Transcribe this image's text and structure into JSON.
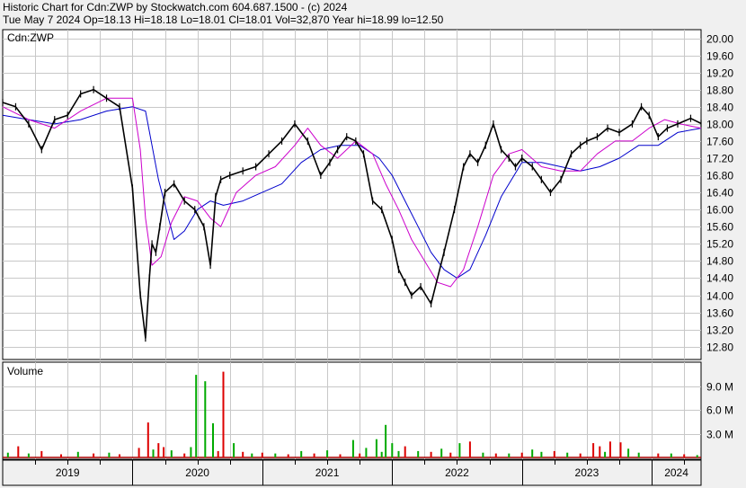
{
  "header": {
    "line1": "Historic Chart for Cdn:ZWP by Stockwatch.com 604.687.1500 - (c) 2024",
    "line2": "Tue May  7 2024  Op=18.13  Hi=18.18  Lo=18.01  Cl=18.01  Vol=32,870  Year hi=18.99  lo=12.50"
  },
  "colors": {
    "price_bars": "#000000",
    "ma_short": "#cc00cc",
    "ma_long": "#0000cc",
    "volume_up": "#00aa00",
    "volume_down": "#dd0000",
    "grid": "#c8c8c8"
  },
  "chart_data": [
    {
      "type": "line",
      "panel": "price",
      "title": "Cdn:ZWP",
      "ylim": [
        12.5,
        20.2
      ],
      "yticks": [
        "20.00",
        "19.60",
        "19.20",
        "18.80",
        "18.40",
        "18.00",
        "17.60",
        "17.20",
        "16.80",
        "16.40",
        "16.00",
        "15.60",
        "15.20",
        "14.80",
        "14.40",
        "14.00",
        "13.60",
        "13.20",
        "12.80"
      ],
      "x_axis_labels": [
        "2019",
        "2020",
        "2021",
        "2022",
        "2023",
        "2024"
      ],
      "x_range": [
        2019.0,
        2024.38
      ],
      "series": [
        {
          "role": "price",
          "x": [
            2019.0,
            2019.1,
            2019.2,
            2019.3,
            2019.4,
            2019.5,
            2019.6,
            2019.7,
            2019.8,
            2019.9,
            2020.0,
            2020.06,
            2020.1,
            2020.13,
            2020.15,
            2020.18,
            2020.21,
            2020.25,
            2020.32,
            2020.4,
            2020.48,
            2020.55,
            2020.6,
            2020.64,
            2020.68,
            2020.75,
            2020.85,
            2020.95,
            2021.05,
            2021.15,
            2021.25,
            2021.35,
            2021.45,
            2021.52,
            2021.58,
            2021.65,
            2021.72,
            2021.78,
            2021.85,
            2021.92,
            2022.0,
            2022.05,
            2022.1,
            2022.15,
            2022.22,
            2022.3,
            2022.4,
            2022.48,
            2022.55,
            2022.6,
            2022.66,
            2022.72,
            2022.78,
            2022.84,
            2022.9,
            2022.95,
            2023.0,
            2023.08,
            2023.15,
            2023.22,
            2023.3,
            2023.38,
            2023.45,
            2023.5,
            2023.58,
            2023.66,
            2023.75,
            2023.85,
            2023.92,
            2023.98,
            2024.05,
            2024.12,
            2024.2,
            2024.3,
            2024.38
          ],
          "y": [
            18.5,
            18.4,
            18.0,
            17.4,
            18.1,
            18.2,
            18.7,
            18.8,
            18.6,
            18.4,
            16.5,
            14.0,
            13.0,
            14.4,
            15.2,
            15.0,
            15.6,
            16.4,
            16.6,
            16.2,
            16.0,
            15.6,
            14.7,
            16.3,
            16.7,
            16.8,
            16.9,
            17.0,
            17.3,
            17.6,
            18.0,
            17.6,
            16.8,
            17.1,
            17.4,
            17.7,
            17.6,
            17.3,
            16.2,
            16.0,
            15.3,
            14.6,
            14.3,
            14.0,
            14.2,
            13.8,
            15.0,
            16.0,
            17.0,
            17.3,
            17.1,
            17.5,
            18.0,
            17.4,
            17.2,
            17.0,
            17.2,
            17.0,
            16.7,
            16.4,
            16.7,
            17.3,
            17.5,
            17.6,
            17.7,
            17.9,
            17.8,
            18.0,
            18.4,
            18.2,
            17.7,
            17.9,
            18.0,
            18.13,
            18.01
          ]
        },
        {
          "role": "ma_short",
          "x": [
            2019.0,
            2019.2,
            2019.4,
            2019.6,
            2019.8,
            2020.0,
            2020.06,
            2020.1,
            2020.15,
            2020.22,
            2020.3,
            2020.4,
            2020.5,
            2020.6,
            2020.68,
            2020.8,
            2020.95,
            2021.1,
            2021.25,
            2021.35,
            2021.45,
            2021.58,
            2021.72,
            2021.85,
            2021.95,
            2022.05,
            2022.15,
            2022.25,
            2022.35,
            2022.45,
            2022.55,
            2022.66,
            2022.78,
            2022.9,
            2023.0,
            2023.15,
            2023.3,
            2023.45,
            2023.58,
            2023.72,
            2023.85,
            2023.98,
            2024.1,
            2024.22,
            2024.38
          ],
          "y": [
            18.4,
            18.1,
            17.9,
            18.3,
            18.6,
            18.6,
            17.4,
            15.8,
            14.7,
            14.9,
            15.7,
            16.3,
            16.2,
            15.8,
            15.6,
            16.4,
            16.8,
            17.0,
            17.5,
            17.9,
            17.5,
            17.2,
            17.6,
            17.3,
            16.6,
            16.0,
            15.3,
            14.8,
            14.3,
            14.2,
            14.6,
            15.6,
            16.8,
            17.3,
            17.4,
            17.0,
            16.9,
            16.9,
            17.3,
            17.6,
            17.6,
            17.9,
            18.1,
            18.0,
            17.9
          ]
        },
        {
          "role": "ma_long",
          "x": [
            2019.0,
            2019.2,
            2019.4,
            2019.6,
            2019.8,
            2020.0,
            2020.1,
            2020.2,
            2020.32,
            2020.4,
            2020.5,
            2020.6,
            2020.7,
            2020.85,
            2021.0,
            2021.15,
            2021.3,
            2021.45,
            2021.6,
            2021.75,
            2021.9,
            2022.0,
            2022.1,
            2022.2,
            2022.3,
            2022.4,
            2022.5,
            2022.6,
            2022.72,
            2022.84,
            2023.0,
            2023.15,
            2023.3,
            2023.45,
            2023.6,
            2023.75,
            2023.9,
            2024.05,
            2024.2,
            2024.38
          ],
          "y": [
            18.2,
            18.1,
            18.0,
            18.1,
            18.3,
            18.4,
            18.3,
            16.7,
            15.3,
            15.5,
            16.0,
            16.2,
            16.1,
            16.2,
            16.4,
            16.6,
            17.1,
            17.4,
            17.5,
            17.5,
            17.2,
            16.8,
            16.2,
            15.6,
            15.0,
            14.6,
            14.4,
            14.6,
            15.4,
            16.3,
            17.1,
            17.1,
            17.0,
            16.9,
            17.0,
            17.2,
            17.5,
            17.5,
            17.8,
            17.9
          ]
        }
      ]
    },
    {
      "type": "bar",
      "panel": "volume",
      "title": "Volume",
      "ylim": [
        0,
        12000000
      ],
      "yticks": [
        "9.0 M",
        "6.0 M",
        "3.0 M"
      ],
      "x_range": [
        2019.0,
        2024.38
      ],
      "series": [
        {
          "role": "volume",
          "x": [
            2019.04,
            2019.12,
            2019.2,
            2019.3,
            2019.45,
            2019.58,
            2019.7,
            2019.82,
            2019.9,
            2020.05,
            2020.12,
            2020.16,
            2020.2,
            2020.24,
            2020.3,
            2020.4,
            2020.45,
            2020.49,
            2020.56,
            2020.62,
            2020.66,
            2020.7,
            2020.78,
            2020.85,
            2020.92,
            2021.0,
            2021.1,
            2021.2,
            2021.3,
            2021.4,
            2021.5,
            2021.6,
            2021.7,
            2021.75,
            2021.8,
            2021.88,
            2021.92,
            2021.95,
            2022.0,
            2022.05,
            2022.1,
            2022.2,
            2022.3,
            2022.38,
            2022.45,
            2022.52,
            2022.6,
            2022.7,
            2022.8,
            2022.9,
            2023.0,
            2023.08,
            2023.15,
            2023.25,
            2023.35,
            2023.45,
            2023.55,
            2023.6,
            2023.64,
            2023.68,
            2023.76,
            2023.82,
            2023.9,
            2024.05,
            2024.15,
            2024.25,
            2024.35
          ],
          "values": [
            600000,
            1400000,
            500000,
            800000,
            400000,
            700000,
            500000,
            600000,
            400000,
            1200000,
            4400000,
            1000000,
            1800000,
            1300000,
            900000,
            500000,
            1300000,
            10400000,
            9600000,
            4300000,
            800000,
            10800000,
            1800000,
            700000,
            500000,
            600000,
            500000,
            400000,
            800000,
            500000,
            900000,
            400000,
            2200000,
            500000,
            1200000,
            2300000,
            700000,
            4100000,
            1800000,
            800000,
            1400000,
            800000,
            700000,
            1100000,
            600000,
            1800000,
            2000000,
            600000,
            500000,
            500000,
            600000,
            1000000,
            700000,
            800000,
            600000,
            500000,
            1800000,
            1400000,
            700000,
            2000000,
            1900000,
            1100000,
            600000,
            500000,
            500000,
            400000,
            300000
          ],
          "directions": [
            "up",
            "down",
            "up",
            "down",
            "down",
            "up",
            "down",
            "up",
            "down",
            "down",
            "down",
            "up",
            "down",
            "down",
            "up",
            "down",
            "up",
            "up",
            "up",
            "up",
            "down",
            "down",
            "up",
            "down",
            "up",
            "down",
            "up",
            "down",
            "up",
            "down",
            "up",
            "down",
            "up",
            "down",
            "up",
            "up",
            "up",
            "up",
            "up",
            "up",
            "down",
            "up",
            "down",
            "up",
            "down",
            "up",
            "down",
            "up",
            "down",
            "up",
            "down",
            "up",
            "up",
            "down",
            "up",
            "down",
            "down",
            "down",
            "up",
            "down",
            "down",
            "up",
            "up",
            "down",
            "up",
            "down",
            "up"
          ]
        }
      ]
    }
  ]
}
